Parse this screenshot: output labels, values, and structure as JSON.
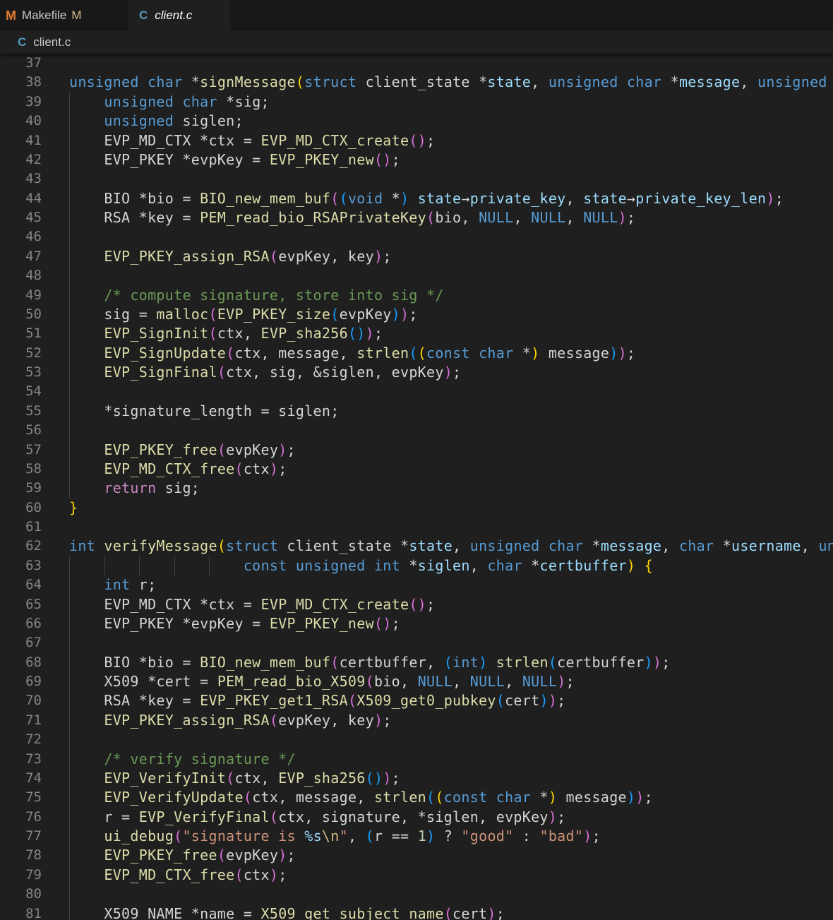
{
  "tabs": [
    {
      "icon": "M",
      "label": "Makefile",
      "badge": "M",
      "active": false
    },
    {
      "icon": "C",
      "label": "client.c",
      "active": true
    }
  ],
  "breadcrumb": {
    "icon": "C",
    "file": "client.c"
  },
  "colors": {
    "background": "#1f1f1f",
    "keyword": "#569cd6",
    "control": "#c586c0",
    "variable": "#9cdcfe",
    "function": "#dcdcaa",
    "comment": "#6a9955",
    "string": "#ce9178",
    "bracket1": "#ffd700",
    "bracket2": "#da70d6",
    "bracket3": "#179fff"
  },
  "lines": [
    {
      "n": "37",
      "guides": 0,
      "tokens": []
    },
    {
      "n": "38",
      "guides": 0,
      "tokens": [
        [
          "k",
          "unsigned"
        ],
        [
          "t",
          " "
        ],
        [
          "k",
          "char"
        ],
        [
          "t",
          " *"
        ],
        [
          "f",
          "signMessage"
        ],
        [
          "b1",
          "("
        ],
        [
          "k",
          "struct"
        ],
        [
          "t",
          " client_state *"
        ],
        [
          "v",
          "state"
        ],
        [
          "t",
          ", "
        ],
        [
          "k",
          "unsigned"
        ],
        [
          "t",
          " "
        ],
        [
          "k",
          "char"
        ],
        [
          "t",
          " *"
        ],
        [
          "v",
          "message"
        ],
        [
          "t",
          ", "
        ],
        [
          "k",
          "unsigned"
        ]
      ]
    },
    {
      "n": "39",
      "guides": 1,
      "tokens": [
        [
          "t",
          "    "
        ],
        [
          "k",
          "unsigned"
        ],
        [
          "t",
          " "
        ],
        [
          "k",
          "char"
        ],
        [
          "t",
          " *sig;"
        ]
      ]
    },
    {
      "n": "40",
      "guides": 1,
      "tokens": [
        [
          "t",
          "    "
        ],
        [
          "k",
          "unsigned"
        ],
        [
          "t",
          " siglen;"
        ]
      ]
    },
    {
      "n": "41",
      "guides": 1,
      "tokens": [
        [
          "t",
          "    EVP_MD_CTX *ctx = "
        ],
        [
          "f",
          "EVP_MD_CTX_create"
        ],
        [
          "b2",
          "()"
        ],
        [
          "t",
          ";"
        ]
      ]
    },
    {
      "n": "42",
      "guides": 1,
      "tokens": [
        [
          "t",
          "    EVP_PKEY *evpKey = "
        ],
        [
          "f",
          "EVP_PKEY_new"
        ],
        [
          "b2",
          "()"
        ],
        [
          "t",
          ";"
        ]
      ]
    },
    {
      "n": "43",
      "guides": 1,
      "tokens": []
    },
    {
      "n": "44",
      "guides": 1,
      "tokens": [
        [
          "t",
          "    BIO *bio = "
        ],
        [
          "f",
          "BIO_new_mem_buf"
        ],
        [
          "b2",
          "("
        ],
        [
          "b3",
          "("
        ],
        [
          "k",
          "void"
        ],
        [
          "t",
          " *"
        ],
        [
          "b3",
          ")"
        ],
        [
          "t",
          " "
        ],
        [
          "v",
          "state"
        ],
        [
          "t",
          "→"
        ],
        [
          "v",
          "private_key"
        ],
        [
          "t",
          ", "
        ],
        [
          "v",
          "state"
        ],
        [
          "t",
          "→"
        ],
        [
          "v",
          "private_key_len"
        ],
        [
          "b2",
          ")"
        ],
        [
          "t",
          ";"
        ]
      ]
    },
    {
      "n": "45",
      "guides": 1,
      "tokens": [
        [
          "t",
          "    RSA *key = "
        ],
        [
          "f",
          "PEM_read_bio_RSAPrivateKey"
        ],
        [
          "b2",
          "("
        ],
        [
          "t",
          "bio, "
        ],
        [
          "k",
          "NULL"
        ],
        [
          "t",
          ", "
        ],
        [
          "k",
          "NULL"
        ],
        [
          "t",
          ", "
        ],
        [
          "k",
          "NULL"
        ],
        [
          "b2",
          ")"
        ],
        [
          "t",
          ";"
        ]
      ]
    },
    {
      "n": "46",
      "guides": 1,
      "tokens": []
    },
    {
      "n": "47",
      "guides": 1,
      "tokens": [
        [
          "t",
          "    "
        ],
        [
          "f",
          "EVP_PKEY_assign_RSA"
        ],
        [
          "b2",
          "("
        ],
        [
          "t",
          "evpKey, key"
        ],
        [
          "b2",
          ")"
        ],
        [
          "t",
          ";"
        ]
      ]
    },
    {
      "n": "48",
      "guides": 1,
      "tokens": []
    },
    {
      "n": "49",
      "guides": 1,
      "tokens": [
        [
          "t",
          "    "
        ],
        [
          "c",
          "/* compute signature, store into sig */"
        ]
      ]
    },
    {
      "n": "50",
      "guides": 1,
      "tokens": [
        [
          "t",
          "    sig = "
        ],
        [
          "f",
          "malloc"
        ],
        [
          "b2",
          "("
        ],
        [
          "f",
          "EVP_PKEY_size"
        ],
        [
          "b3",
          "("
        ],
        [
          "t",
          "evpKey"
        ],
        [
          "b3",
          ")"
        ],
        [
          "b2",
          ")"
        ],
        [
          "t",
          ";"
        ]
      ]
    },
    {
      "n": "51",
      "guides": 1,
      "tokens": [
        [
          "t",
          "    "
        ],
        [
          "f",
          "EVP_SignInit"
        ],
        [
          "b2",
          "("
        ],
        [
          "t",
          "ctx, "
        ],
        [
          "f",
          "EVP_sha256"
        ],
        [
          "b3",
          "()"
        ],
        [
          "b2",
          ")"
        ],
        [
          "t",
          ";"
        ]
      ]
    },
    {
      "n": "52",
      "guides": 1,
      "tokens": [
        [
          "t",
          "    "
        ],
        [
          "f",
          "EVP_SignUpdate"
        ],
        [
          "b2",
          "("
        ],
        [
          "t",
          "ctx, message, "
        ],
        [
          "f",
          "strlen"
        ],
        [
          "b3",
          "("
        ],
        [
          "b1",
          "("
        ],
        [
          "k",
          "const"
        ],
        [
          "t",
          " "
        ],
        [
          "k",
          "char"
        ],
        [
          "t",
          " *"
        ],
        [
          "b1",
          ")"
        ],
        [
          "t",
          " message"
        ],
        [
          "b3",
          ")"
        ],
        [
          "b2",
          ")"
        ],
        [
          "t",
          ";"
        ]
      ]
    },
    {
      "n": "53",
      "guides": 1,
      "tokens": [
        [
          "t",
          "    "
        ],
        [
          "f",
          "EVP_SignFinal"
        ],
        [
          "b2",
          "("
        ],
        [
          "t",
          "ctx, sig, &siglen, evpKey"
        ],
        [
          "b2",
          ")"
        ],
        [
          "t",
          ";"
        ]
      ]
    },
    {
      "n": "54",
      "guides": 1,
      "tokens": []
    },
    {
      "n": "55",
      "guides": 1,
      "tokens": [
        [
          "t",
          "    *signature_length = siglen;"
        ]
      ]
    },
    {
      "n": "56",
      "guides": 1,
      "tokens": []
    },
    {
      "n": "57",
      "guides": 1,
      "tokens": [
        [
          "t",
          "    "
        ],
        [
          "f",
          "EVP_PKEY_free"
        ],
        [
          "b2",
          "("
        ],
        [
          "t",
          "evpKey"
        ],
        [
          "b2",
          ")"
        ],
        [
          "t",
          ";"
        ]
      ]
    },
    {
      "n": "58",
      "guides": 1,
      "tokens": [
        [
          "t",
          "    "
        ],
        [
          "f",
          "EVP_MD_CTX_free"
        ],
        [
          "b2",
          "("
        ],
        [
          "t",
          "ctx"
        ],
        [
          "b2",
          ")"
        ],
        [
          "t",
          ";"
        ]
      ]
    },
    {
      "n": "59",
      "guides": 1,
      "tokens": [
        [
          "t",
          "    "
        ],
        [
          "kc",
          "return"
        ],
        [
          "t",
          " sig;"
        ]
      ]
    },
    {
      "n": "60",
      "guides": 0,
      "tokens": [
        [
          "b1",
          "}"
        ]
      ]
    },
    {
      "n": "61",
      "guides": 0,
      "tokens": []
    },
    {
      "n": "62",
      "guides": 0,
      "tokens": [
        [
          "k",
          "int"
        ],
        [
          "t",
          " "
        ],
        [
          "f",
          "verifyMessage"
        ],
        [
          "b1",
          "("
        ],
        [
          "k",
          "struct"
        ],
        [
          "t",
          " client_state *"
        ],
        [
          "v",
          "state"
        ],
        [
          "t",
          ", "
        ],
        [
          "k",
          "unsigned"
        ],
        [
          "t",
          " "
        ],
        [
          "k",
          "char"
        ],
        [
          "t",
          " *"
        ],
        [
          "v",
          "message"
        ],
        [
          "t",
          ", "
        ],
        [
          "k",
          "char"
        ],
        [
          "t",
          " *"
        ],
        [
          "v",
          "username"
        ],
        [
          "t",
          ", "
        ],
        [
          "k",
          "un"
        ]
      ]
    },
    {
      "n": "63",
      "guides": 5,
      "tokens": [
        [
          "t",
          "                    "
        ],
        [
          "k",
          "const"
        ],
        [
          "t",
          " "
        ],
        [
          "k",
          "unsigned"
        ],
        [
          "t",
          " "
        ],
        [
          "k",
          "int"
        ],
        [
          "t",
          " *"
        ],
        [
          "v",
          "siglen"
        ],
        [
          "t",
          ", "
        ],
        [
          "k",
          "char"
        ],
        [
          "t",
          " *"
        ],
        [
          "v",
          "certbuffer"
        ],
        [
          "b1",
          ")"
        ],
        [
          "t",
          " "
        ],
        [
          "b1",
          "{"
        ]
      ]
    },
    {
      "n": "64",
      "guides": 1,
      "tokens": [
        [
          "t",
          "    "
        ],
        [
          "k",
          "int"
        ],
        [
          "t",
          " r;"
        ]
      ]
    },
    {
      "n": "65",
      "guides": 1,
      "tokens": [
        [
          "t",
          "    EVP_MD_CTX *ctx = "
        ],
        [
          "f",
          "EVP_MD_CTX_create"
        ],
        [
          "b2",
          "()"
        ],
        [
          "t",
          ";"
        ]
      ]
    },
    {
      "n": "66",
      "guides": 1,
      "tokens": [
        [
          "t",
          "    EVP_PKEY *evpKey = "
        ],
        [
          "f",
          "EVP_PKEY_new"
        ],
        [
          "b2",
          "()"
        ],
        [
          "t",
          ";"
        ]
      ]
    },
    {
      "n": "67",
      "guides": 1,
      "tokens": []
    },
    {
      "n": "68",
      "guides": 1,
      "tokens": [
        [
          "t",
          "    BIO *bio = "
        ],
        [
          "f",
          "BIO_new_mem_buf"
        ],
        [
          "b2",
          "("
        ],
        [
          "t",
          "certbuffer, "
        ],
        [
          "b3",
          "("
        ],
        [
          "k",
          "int"
        ],
        [
          "b3",
          ")"
        ],
        [
          "t",
          " "
        ],
        [
          "f",
          "strlen"
        ],
        [
          "b3",
          "("
        ],
        [
          "t",
          "certbuffer"
        ],
        [
          "b3",
          ")"
        ],
        [
          "b2",
          ")"
        ],
        [
          "t",
          ";"
        ]
      ]
    },
    {
      "n": "69",
      "guides": 1,
      "tokens": [
        [
          "t",
          "    X509 *cert = "
        ],
        [
          "f",
          "PEM_read_bio_X509"
        ],
        [
          "b2",
          "("
        ],
        [
          "t",
          "bio, "
        ],
        [
          "k",
          "NULL"
        ],
        [
          "t",
          ", "
        ],
        [
          "k",
          "NULL"
        ],
        [
          "t",
          ", "
        ],
        [
          "k",
          "NULL"
        ],
        [
          "b2",
          ")"
        ],
        [
          "t",
          ";"
        ]
      ]
    },
    {
      "n": "70",
      "guides": 1,
      "tokens": [
        [
          "t",
          "    RSA *key = "
        ],
        [
          "f",
          "EVP_PKEY_get1_RSA"
        ],
        [
          "b2",
          "("
        ],
        [
          "f",
          "X509_get0_pubkey"
        ],
        [
          "b3",
          "("
        ],
        [
          "t",
          "cert"
        ],
        [
          "b3",
          ")"
        ],
        [
          "b2",
          ")"
        ],
        [
          "t",
          ";"
        ]
      ]
    },
    {
      "n": "71",
      "guides": 1,
      "tokens": [
        [
          "t",
          "    "
        ],
        [
          "f",
          "EVP_PKEY_assign_RSA"
        ],
        [
          "b2",
          "("
        ],
        [
          "t",
          "evpKey, key"
        ],
        [
          "b2",
          ")"
        ],
        [
          "t",
          ";"
        ]
      ]
    },
    {
      "n": "72",
      "guides": 1,
      "tokens": []
    },
    {
      "n": "73",
      "guides": 1,
      "tokens": [
        [
          "t",
          "    "
        ],
        [
          "c",
          "/* verify signature */"
        ]
      ]
    },
    {
      "n": "74",
      "guides": 1,
      "tokens": [
        [
          "t",
          "    "
        ],
        [
          "f",
          "EVP_VerifyInit"
        ],
        [
          "b2",
          "("
        ],
        [
          "t",
          "ctx, "
        ],
        [
          "f",
          "EVP_sha256"
        ],
        [
          "b3",
          "()"
        ],
        [
          "b2",
          ")"
        ],
        [
          "t",
          ";"
        ]
      ]
    },
    {
      "n": "75",
      "guides": 1,
      "tokens": [
        [
          "t",
          "    "
        ],
        [
          "f",
          "EVP_VerifyUpdate"
        ],
        [
          "b2",
          "("
        ],
        [
          "t",
          "ctx, message, "
        ],
        [
          "f",
          "strlen"
        ],
        [
          "b3",
          "("
        ],
        [
          "b1",
          "("
        ],
        [
          "k",
          "const"
        ],
        [
          "t",
          " "
        ],
        [
          "k",
          "char"
        ],
        [
          "t",
          " *"
        ],
        [
          "b1",
          ")"
        ],
        [
          "t",
          " message"
        ],
        [
          "b3",
          ")"
        ],
        [
          "b2",
          ")"
        ],
        [
          "t",
          ";"
        ]
      ]
    },
    {
      "n": "76",
      "guides": 1,
      "tokens": [
        [
          "t",
          "    r = "
        ],
        [
          "f",
          "EVP_VerifyFinal"
        ],
        [
          "b2",
          "("
        ],
        [
          "t",
          "ctx, signature, *siglen, evpKey"
        ],
        [
          "b2",
          ")"
        ],
        [
          "t",
          ";"
        ]
      ]
    },
    {
      "n": "77",
      "guides": 1,
      "tokens": [
        [
          "t",
          "    "
        ],
        [
          "f",
          "ui_debug"
        ],
        [
          "b2",
          "("
        ],
        [
          "s",
          "\"signature is "
        ],
        [
          "v",
          "%s"
        ],
        [
          "e",
          "\\n"
        ],
        [
          "s",
          "\""
        ],
        [
          "t",
          ", "
        ],
        [
          "b3",
          "("
        ],
        [
          "t",
          "r == "
        ],
        [
          "n",
          "1"
        ],
        [
          "b3",
          ")"
        ],
        [
          "t",
          " ? "
        ],
        [
          "s",
          "\"good\""
        ],
        [
          "t",
          " : "
        ],
        [
          "s",
          "\"bad\""
        ],
        [
          "b2",
          ")"
        ],
        [
          "t",
          ";"
        ]
      ]
    },
    {
      "n": "78",
      "guides": 1,
      "tokens": [
        [
          "t",
          "    "
        ],
        [
          "f",
          "EVP_PKEY_free"
        ],
        [
          "b2",
          "("
        ],
        [
          "t",
          "evpKey"
        ],
        [
          "b2",
          ")"
        ],
        [
          "t",
          ";"
        ]
      ]
    },
    {
      "n": "79",
      "guides": 1,
      "tokens": [
        [
          "t",
          "    "
        ],
        [
          "f",
          "EVP_MD_CTX_free"
        ],
        [
          "b2",
          "("
        ],
        [
          "t",
          "ctx"
        ],
        [
          "b2",
          ")"
        ],
        [
          "t",
          ";"
        ]
      ]
    },
    {
      "n": "80",
      "guides": 1,
      "tokens": []
    },
    {
      "n": "81",
      "guides": 1,
      "tokens": [
        [
          "t",
          "    X509_NAME *name = "
        ],
        [
          "f",
          "X509_get_subject_name"
        ],
        [
          "b2",
          "("
        ],
        [
          "t",
          "cert"
        ],
        [
          "b2",
          ")"
        ],
        [
          "t",
          ";"
        ]
      ]
    }
  ]
}
